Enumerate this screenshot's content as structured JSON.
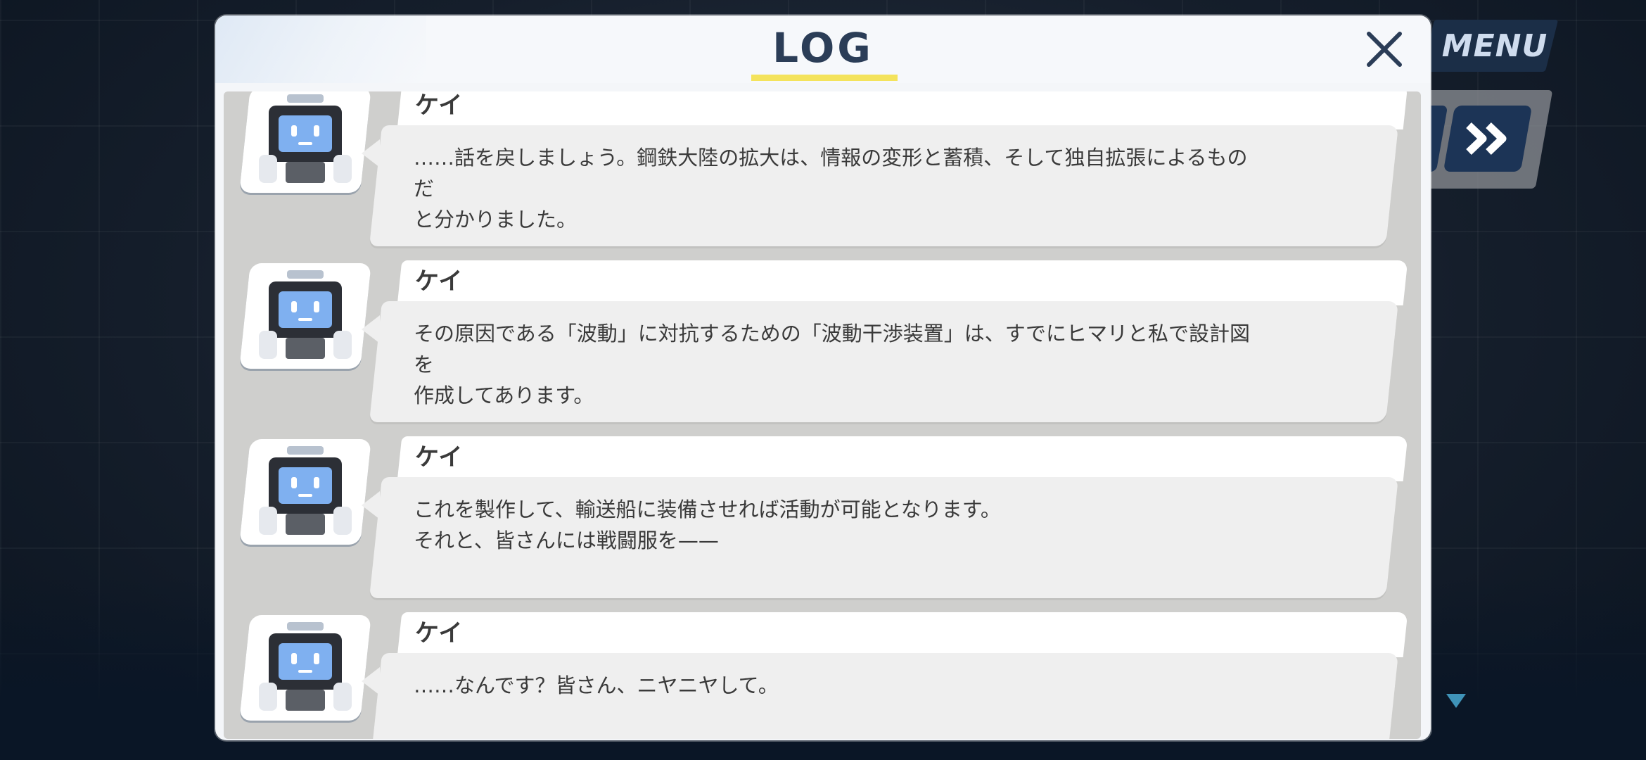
{
  "log_title": "LOG",
  "menu_label": "MENU",
  "icons": {
    "close": "close-icon",
    "fast_forward": "fast-forward-icon",
    "scroll_down": "triangle-down-icon",
    "avatar": "robot-avatar-icon"
  },
  "colors": {
    "title": "#2b3d57",
    "underline": "#f4e35c",
    "menu_bg": "#1b2e47",
    "bubble": "#efefef",
    "log_bg": "#cfcfcd"
  },
  "entries": [
    {
      "speaker": "ケイ",
      "text": "……話を戻しましょう。鋼鉄大陸の拡大は、情報の変形と蓄積、そして独自拡張によるものだ\nと分かりました。"
    },
    {
      "speaker": "ケイ",
      "text": "その原因である「波動」に対抗するための「波動干渉装置」は、すでにヒマリと私で設計図を\n作成してあります。"
    },
    {
      "speaker": "ケイ",
      "text": "これを製作して、輸送船に装備させれば活動が可能となります。\nそれと、皆さんには戦闘服を——"
    },
    {
      "speaker": "ケイ",
      "text": "……なんです？皆さん、ニヤニヤして。"
    }
  ]
}
